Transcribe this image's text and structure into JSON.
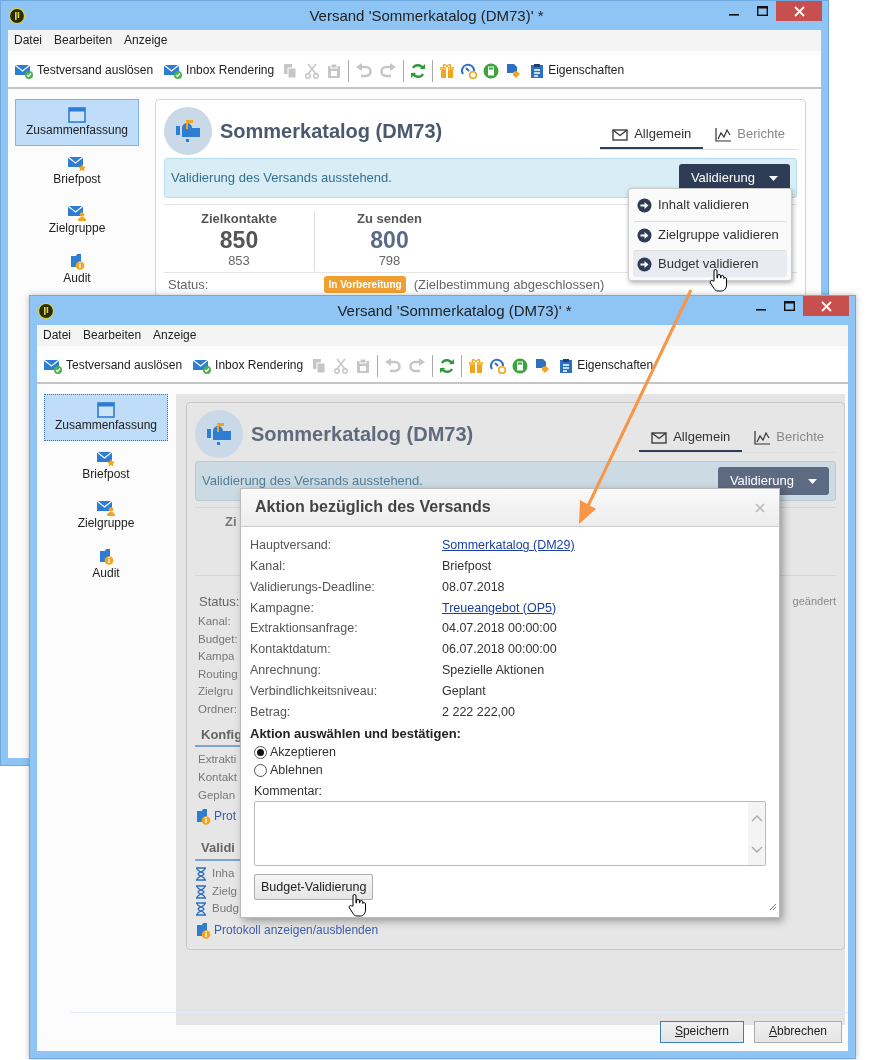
{
  "windows": [
    {
      "title": "Versand 'Sommerkatalog (DM73)' *",
      "menu": [
        "Datei",
        "Bearbeiten",
        "Anzeige"
      ],
      "toolbar": {
        "actions": [
          "Testversand auslösen",
          "Inbox Rendering"
        ],
        "edit_disabled": true,
        "properties": "Eigenschaften"
      },
      "sidebar": [
        {
          "label": "Zusammenfassung",
          "selected": true
        },
        {
          "label": "Briefpost",
          "selected": false
        },
        {
          "label": "Zielgruppe",
          "selected": false
        },
        {
          "label": "Audit",
          "selected": false
        }
      ],
      "card": {
        "disabled": false,
        "title": "Sommerkatalog (DM73)",
        "tabs": [
          {
            "label": "Allgemein",
            "selected": true
          },
          {
            "label": "Berichte",
            "selected": false
          }
        ],
        "alert": "Validierung des Versands ausstehend.",
        "action_button": "Validierung",
        "stats": [
          {
            "label": "Zielkontakte",
            "value": "850",
            "sub": "853"
          },
          {
            "label": "Zu senden",
            "value": "800",
            "sub": "798"
          }
        ],
        "status": {
          "label": "Status:",
          "badge": "In Vorbereitung",
          "note": "(Zielbestimmung abgeschlossen)"
        }
      },
      "dropdown": [
        {
          "label": "Inhalt validieren",
          "selected": false
        },
        {
          "label": "Zielgruppe validieren",
          "selected": false
        },
        {
          "label": "Budget validieren",
          "selected": true
        }
      ]
    },
    {
      "title": "Versand 'Sommerkatalog (DM73)' *",
      "menu": [
        "Datei",
        "Bearbeiten",
        "Anzeige"
      ],
      "toolbar": {
        "actions": [
          "Testversand auslösen",
          "Inbox Rendering"
        ],
        "edit_disabled": true,
        "properties": "Eigenschaften"
      },
      "sidebar": [
        {
          "label": "Zusammenfassung",
          "selected": true
        },
        {
          "label": "Briefpost",
          "selected": false
        },
        {
          "label": "Zielgruppe",
          "selected": false
        },
        {
          "label": "Audit",
          "selected": false
        }
      ],
      "card": {
        "disabled": true,
        "title": "Sommerkatalog (DM73)",
        "tabs": [
          {
            "label": "Allgemein",
            "selected": true
          },
          {
            "label": "Berichte",
            "selected": false
          }
        ],
        "alert": "Validierung des Versands ausstehend.",
        "action_button": "Validierung",
        "stats": [
          {
            "label": "Zi"
          }
        ],
        "status": {
          "label": "Status:",
          "modified": "geändert"
        },
        "fields": [
          "Kanal:",
          "Budget:",
          "Kampa",
          "Routing",
          "Zielgru",
          "Ordner:"
        ],
        "sections": [
          {
            "heading": "Konfig",
            "kind": "plain",
            "items": [
              "Extrakti",
              "Kontakt",
              "Geplan"
            ],
            "link": "Prot"
          },
          {
            "heading": "Validi",
            "kind": "pending",
            "items": [
              "Inha",
              "Zielg",
              "Budg"
            ],
            "link": "Protokoll anzeigen/ausblenden"
          }
        ]
      },
      "dialog": {
        "title": "Aktion bezüglich des Versands",
        "fields": [
          {
            "label": "Hauptversand:",
            "value": "Sommerkatalog (DM29)",
            "link": true
          },
          {
            "label": "Kanal:",
            "value": "Briefpost",
            "link": false
          },
          {
            "label": "Validierungs-Deadline:",
            "value": "08.07.2018",
            "link": false
          },
          {
            "label": "Kampagne:",
            "value": "Treueangebot (OP5)",
            "link": true
          },
          {
            "label": "Extraktionsanfrage:",
            "value": "04.07.2018 00:00:00",
            "link": false
          },
          {
            "label": "Kontaktdatum:",
            "value": "06.07.2018 00:00:00",
            "link": false
          },
          {
            "label": "Anrechnung:",
            "value": "Spezielle Aktionen",
            "link": false
          },
          {
            "label": "Verbindlichkeitsniveau:",
            "value": "Geplant",
            "link": false
          },
          {
            "label": "Betrag:",
            "value": "2 222 222,00",
            "link": false
          }
        ],
        "prompt": "Aktion auswählen und bestätigen:",
        "options": [
          {
            "label": "Akzeptieren",
            "selected": true
          },
          {
            "label": "Ablehnen",
            "selected": false
          }
        ],
        "comment_label": "Kommentar:",
        "button": "Budget-Validierung"
      },
      "footer": [
        {
          "label": "Speichern",
          "default": true
        },
        {
          "label": "Abbrechen",
          "default": false
        }
      ]
    }
  ]
}
